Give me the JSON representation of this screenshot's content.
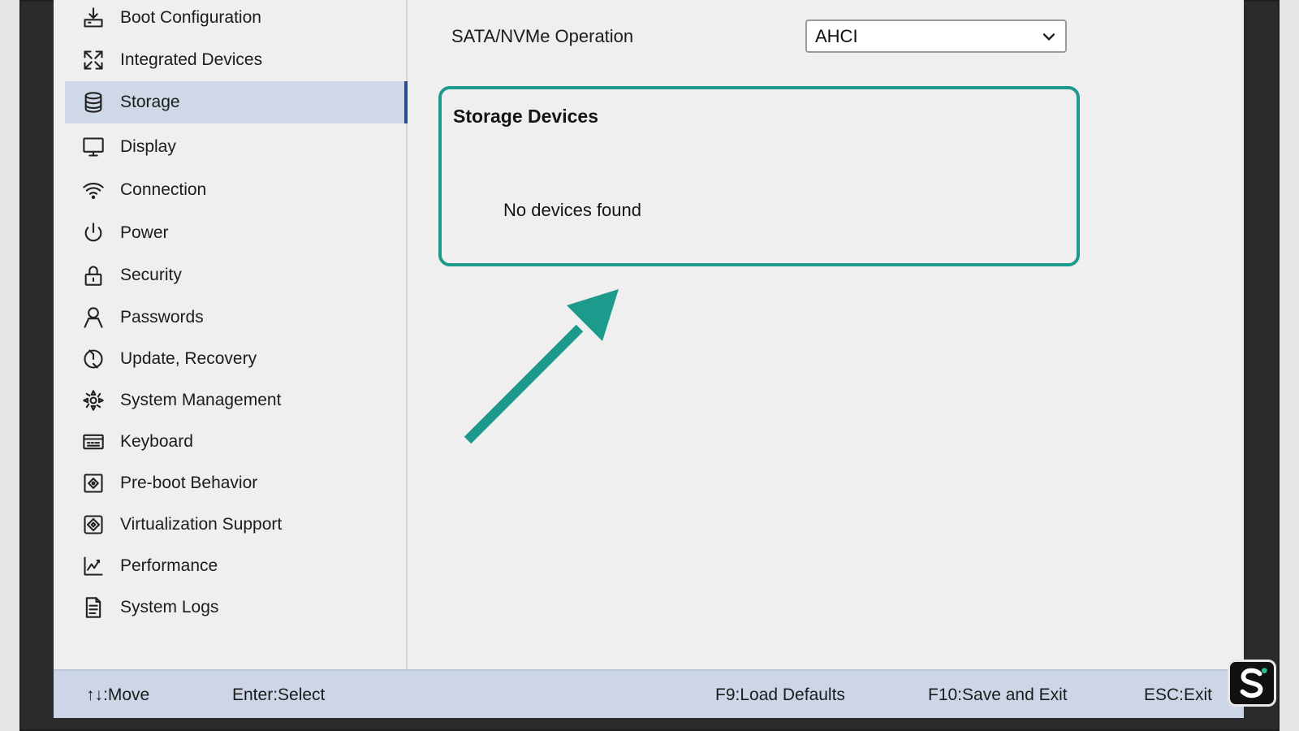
{
  "sidebar": {
    "items": [
      {
        "label": "Boot Configuration",
        "icon": "boot-icon"
      },
      {
        "label": "Integrated Devices",
        "icon": "integrated-devices-icon"
      },
      {
        "label": "Storage",
        "icon": "database-icon",
        "active": true
      },
      {
        "label": "Display",
        "icon": "monitor-icon"
      },
      {
        "label": "Connection",
        "icon": "wifi-icon"
      },
      {
        "label": "Power",
        "icon": "power-icon"
      },
      {
        "label": "Security",
        "icon": "lock-icon"
      },
      {
        "label": "Passwords",
        "icon": "user-icon"
      },
      {
        "label": "Update, Recovery",
        "icon": "update-icon"
      },
      {
        "label": "System Management",
        "icon": "system-management-icon"
      },
      {
        "label": "Keyboard",
        "icon": "keyboard-icon"
      },
      {
        "label": "Pre-boot Behavior",
        "icon": "preboot-icon"
      },
      {
        "label": "Virtualization Support",
        "icon": "virtualization-icon"
      },
      {
        "label": "Performance",
        "icon": "performance-icon"
      },
      {
        "label": "System Logs",
        "icon": "logs-icon"
      }
    ]
  },
  "main": {
    "sata_label": "SATA/NVMe Operation",
    "sata_value": "AHCI",
    "devices_title": "Storage Devices",
    "devices_empty": "No devices found"
  },
  "footer": {
    "move": "↑↓:Move",
    "select": "Enter:Select",
    "load_defaults": "F9:Load Defaults",
    "save_exit": "F10:Save and Exit",
    "exit": "ESC:Exit"
  },
  "colors": {
    "accent": "#1c9a8c",
    "active_bg": "#cfd8e6",
    "footer_bg": "#ccd6e6"
  }
}
